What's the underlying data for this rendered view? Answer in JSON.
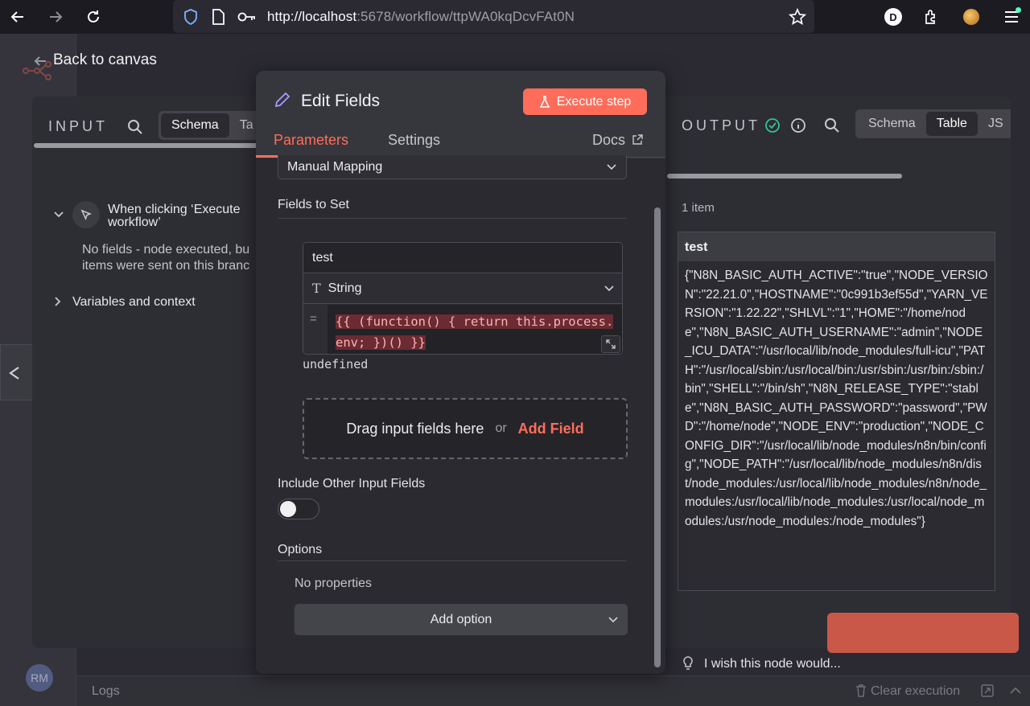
{
  "browser": {
    "url_host": "http://localhost",
    "url_rest": ":5678/workflow/ttpWA0kqDcvFAt0N",
    "profile_initial": "D"
  },
  "canvas": {
    "back_label": "Back to canvas",
    "logs_label": "Logs",
    "clear_execution_label": "Clear execution",
    "avatar_initials": "RM"
  },
  "input_panel": {
    "label": "INPUT",
    "tabs": [
      "Schema",
      "Ta"
    ],
    "trigger_name": "When clicking ‘Execute workflow’",
    "no_fields_line1": "No fields - node executed, bu",
    "no_fields_line2": "items were sent on this branc",
    "variables_label": "Variables and context"
  },
  "modal": {
    "title": "Edit Fields",
    "execute_label": "Execute step",
    "tabs": {
      "parameters": "Parameters",
      "settings": "Settings",
      "docs": "Docs"
    },
    "mode_value": "Manual Mapping",
    "fields_to_set_label": "Fields to Set",
    "field": {
      "name": "test",
      "type": "String",
      "expression_line1": "{{ (function() { return this.process.",
      "expression_line2": "env; })() }}",
      "result": "undefined"
    },
    "drop_text": "Drag input fields here",
    "or_text": "or",
    "add_field_label": "Add Field",
    "include_other_label": "Include Other Input Fields",
    "include_other_value": false,
    "options_label": "Options",
    "no_properties": "No properties",
    "add_option_label": "Add option"
  },
  "output_panel": {
    "label": "OUTPUT",
    "tabs": [
      "Schema",
      "Table",
      "JS"
    ],
    "active_tab": "Table",
    "item_count": "1 item",
    "column": "test",
    "cell_value": "{\"N8N_BASIC_AUTH_ACTIVE\":\"true\",\"NODE_VERSION\":\"22.21.0\",\"HOSTNAME\":\"0c991b3ef55d\",\"YARN_VERSION\":\"1.22.22\",\"SHLVL\":\"1\",\"HOME\":\"/home/node\",\"N8N_BASIC_AUTH_USERNAME\":\"admin\",\"NODE_ICU_DATA\":\"/usr/local/lib/node_modules/full-icu\",\"PATH\":\"/usr/local/sbin:/usr/local/bin:/usr/sbin:/usr/bin:/sbin:/bin\",\"SHELL\":\"/bin/sh\",\"N8N_RELEASE_TYPE\":\"stable\",\"N8N_BASIC_AUTH_PASSWORD\":\"password\",\"PWD\":\"/home/node\",\"NODE_ENV\":\"production\",\"NODE_CONFIG_DIR\":\"/usr/local/lib/node_modules/n8n/bin/config\",\"NODE_PATH\":\"/usr/local/lib/node_modules/n8n/dist/node_modules:/usr/local/lib/node_modules/n8n/node_modules:/usr/local/lib/node_modules:/usr/local/node_modules:/usr/node_modules:/node_modules\"}",
    "feedback_text": "I wish this node would..."
  },
  "colors": {
    "accent": "#ff6d5a",
    "success": "#34c38f"
  }
}
